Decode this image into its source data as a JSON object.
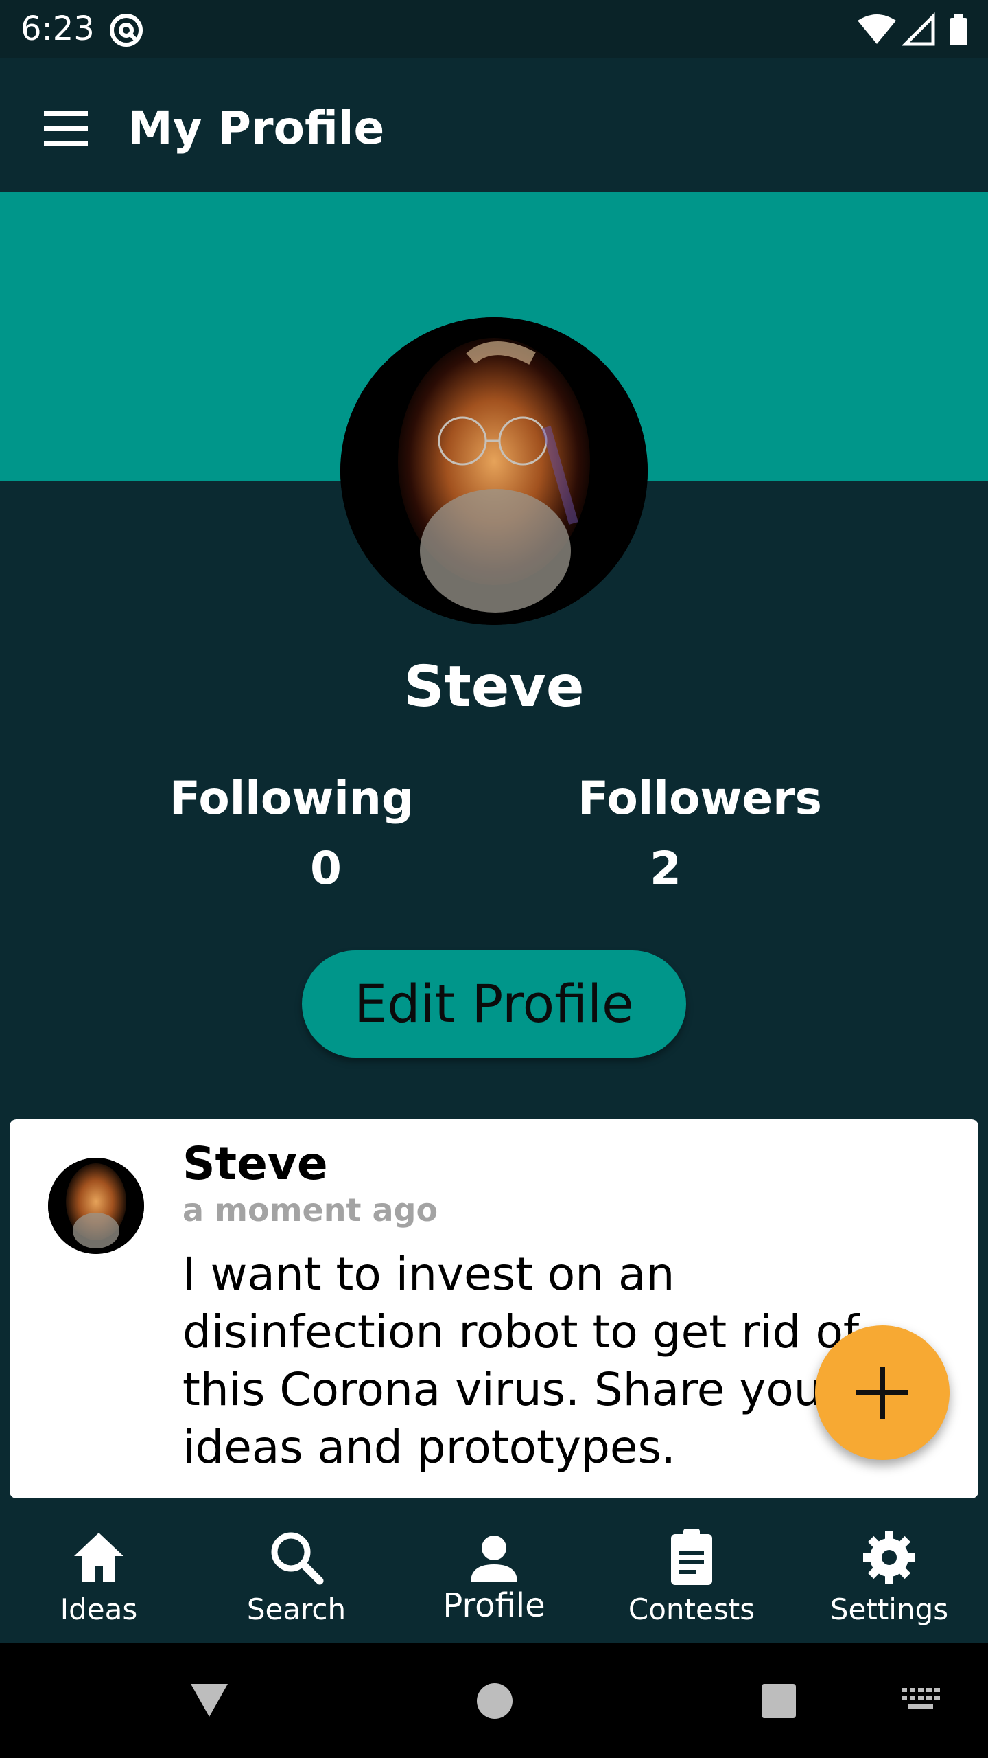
{
  "status_bar": {
    "time": "6:23"
  },
  "app_bar": {
    "title": "My Profile"
  },
  "profile": {
    "name": "Steve",
    "following_label": "Following",
    "following_count": "0",
    "followers_label": "Followers",
    "followers_count": "2",
    "edit_button_label": "Edit Profile"
  },
  "post": {
    "author": "Steve",
    "time": "a moment ago",
    "text": "I want to invest on an disinfection robot to get rid of this Corona virus. Share your ideas and prototypes."
  },
  "bottom_nav": {
    "items": [
      {
        "label": "Ideas",
        "icon": "home-icon"
      },
      {
        "label": "Search",
        "icon": "search-icon"
      },
      {
        "label": "Profile",
        "icon": "person-icon"
      },
      {
        "label": "Contests",
        "icon": "clipboard-icon"
      },
      {
        "label": "Settings",
        "icon": "gear-icon"
      }
    ],
    "active": "Profile"
  },
  "colors": {
    "background": "#0b2a31",
    "accent_teal": "#00968a",
    "fab_orange": "#f7a933",
    "card": "#ffffff"
  }
}
